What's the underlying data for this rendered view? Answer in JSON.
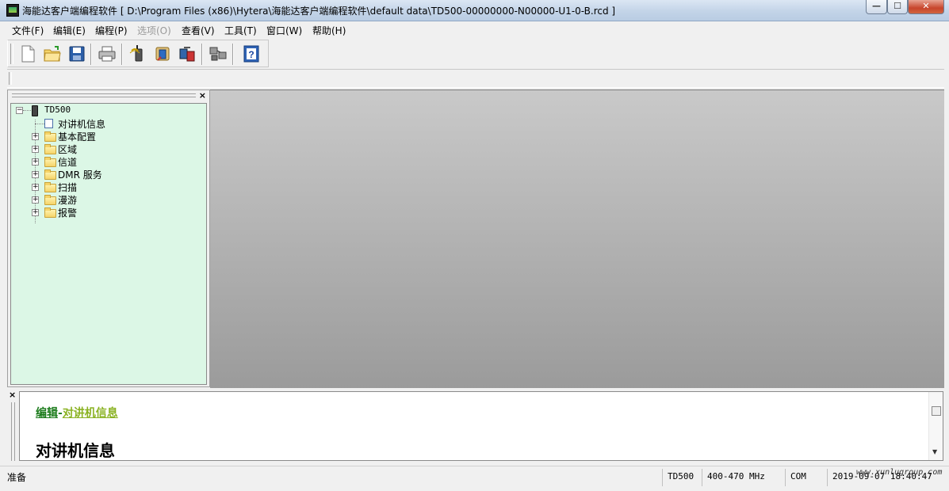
{
  "window": {
    "title": "海能达客户端编程软件 [ D:\\Program Files (x86)\\Hytera\\海能达客户端编程软件\\default data\\TD500-00000000-N00000-U1-0-B.rcd ]",
    "minimize": "—",
    "maximize": "☐",
    "close": "✕"
  },
  "menu": {
    "file": "文件(F)",
    "edit": "编辑(E)",
    "program": "编程(P)",
    "options": "选项(O)",
    "view": "查看(V)",
    "tools": "工具(T)",
    "window": "窗口(W)",
    "help": "帮助(H)"
  },
  "toolbar": {
    "icons": [
      "new-file-icon",
      "open-folder-icon",
      "save-icon",
      "print-icon",
      "read-radio-icon",
      "write-radio-icon",
      "clone-radio-icon",
      "network-icon",
      "help-icon"
    ]
  },
  "tree": {
    "close": "×",
    "root": "TD500",
    "items": [
      "对讲机信息",
      "基本配置",
      "区域",
      "信道",
      "DMR 服务",
      "扫描",
      "漫游",
      "报警"
    ]
  },
  "bottom": {
    "close": "×",
    "crumb_edit": "编辑",
    "crumb_sep": "-",
    "crumb_page": "对讲机信息",
    "heading": "对讲机信息"
  },
  "status": {
    "ready": "准备",
    "model": "TD500",
    "band": "400-470 MHz",
    "port": "COM",
    "datetime": "2019-09-07 18:40:47",
    "watermark": "www.xunlugroup.com"
  },
  "colors": {
    "tree_bg": "#dcf7e6",
    "crumb_link": "#1b7b1b",
    "crumb_current": "#8ab222"
  }
}
